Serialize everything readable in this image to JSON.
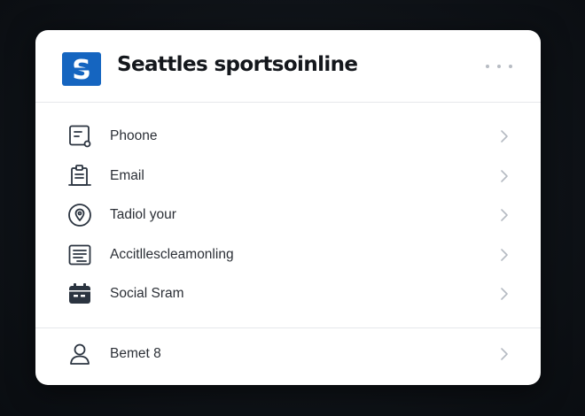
{
  "header": {
    "logo_letter": "S",
    "title": "Seattles sportsoinline",
    "more_icon": "more-horizontal-icon"
  },
  "menu": {
    "items": [
      {
        "label": "Phoone",
        "icon": "phone-card-icon"
      },
      {
        "label": "Email",
        "icon": "clipboard-icon"
      },
      {
        "label": "Tadiol your",
        "icon": "location-pin-icon"
      },
      {
        "label": "Accitllescleamonling",
        "icon": "document-list-icon"
      },
      {
        "label": "Social Sram",
        "icon": "calendar-icon"
      }
    ]
  },
  "footer": {
    "label": "Bemet 8",
    "icon": "user-icon"
  },
  "colors": {
    "brand": "#1565c0",
    "icon_stroke": "#2b3440",
    "chevron": "#b5bac2",
    "card": "#ffffff",
    "background": "#0d1117"
  }
}
